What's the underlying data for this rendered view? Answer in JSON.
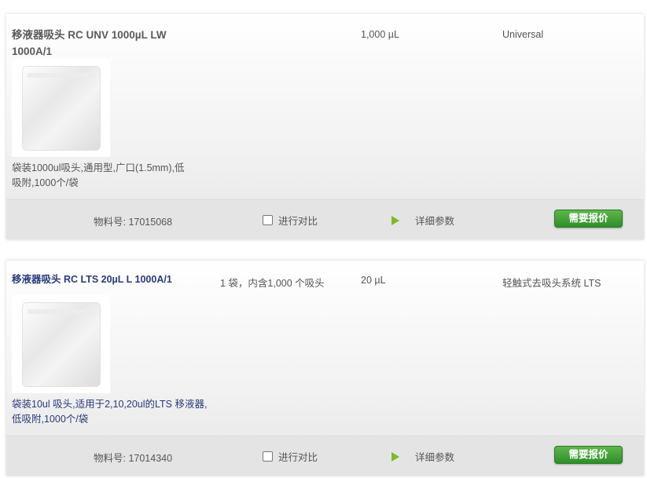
{
  "products": [
    {
      "title": "移液器吸头 RC UNV 1000µL LW 1000A/1",
      "pack": "",
      "volume": "1,000 µL",
      "system": "Universal",
      "description": "袋装1000ul吸头,通用型,广口(1.5mm),低吸附,1000个/袋",
      "item_no": "物料号: 17015068",
      "compare_label": "进行对比",
      "details_label": "详细参数",
      "quote_label": "需要报价"
    },
    {
      "title": "移液器吸头 RC LTS 20µL L 1000A/1",
      "pack": "1 袋，内含1,000 个吸头",
      "volume": "20 µL",
      "system": "轻触式去吸头系统 LTS",
      "description": "袋装10ul 吸头,适用于2,10,20ul的LTS 移液器, 低吸附,1000个/袋",
      "item_no": "物料号: 17014340",
      "compare_label": "进行对比",
      "details_label": "详细参数",
      "quote_label": "需要报价"
    }
  ],
  "colors": {
    "accent_green": "#3a9a33",
    "title_blue": "#283a7a",
    "arrow_green": "#7cbb26"
  },
  "icons": {
    "details_arrow": "play-arrow-icon",
    "compare_checkbox": "checkbox-icon"
  }
}
